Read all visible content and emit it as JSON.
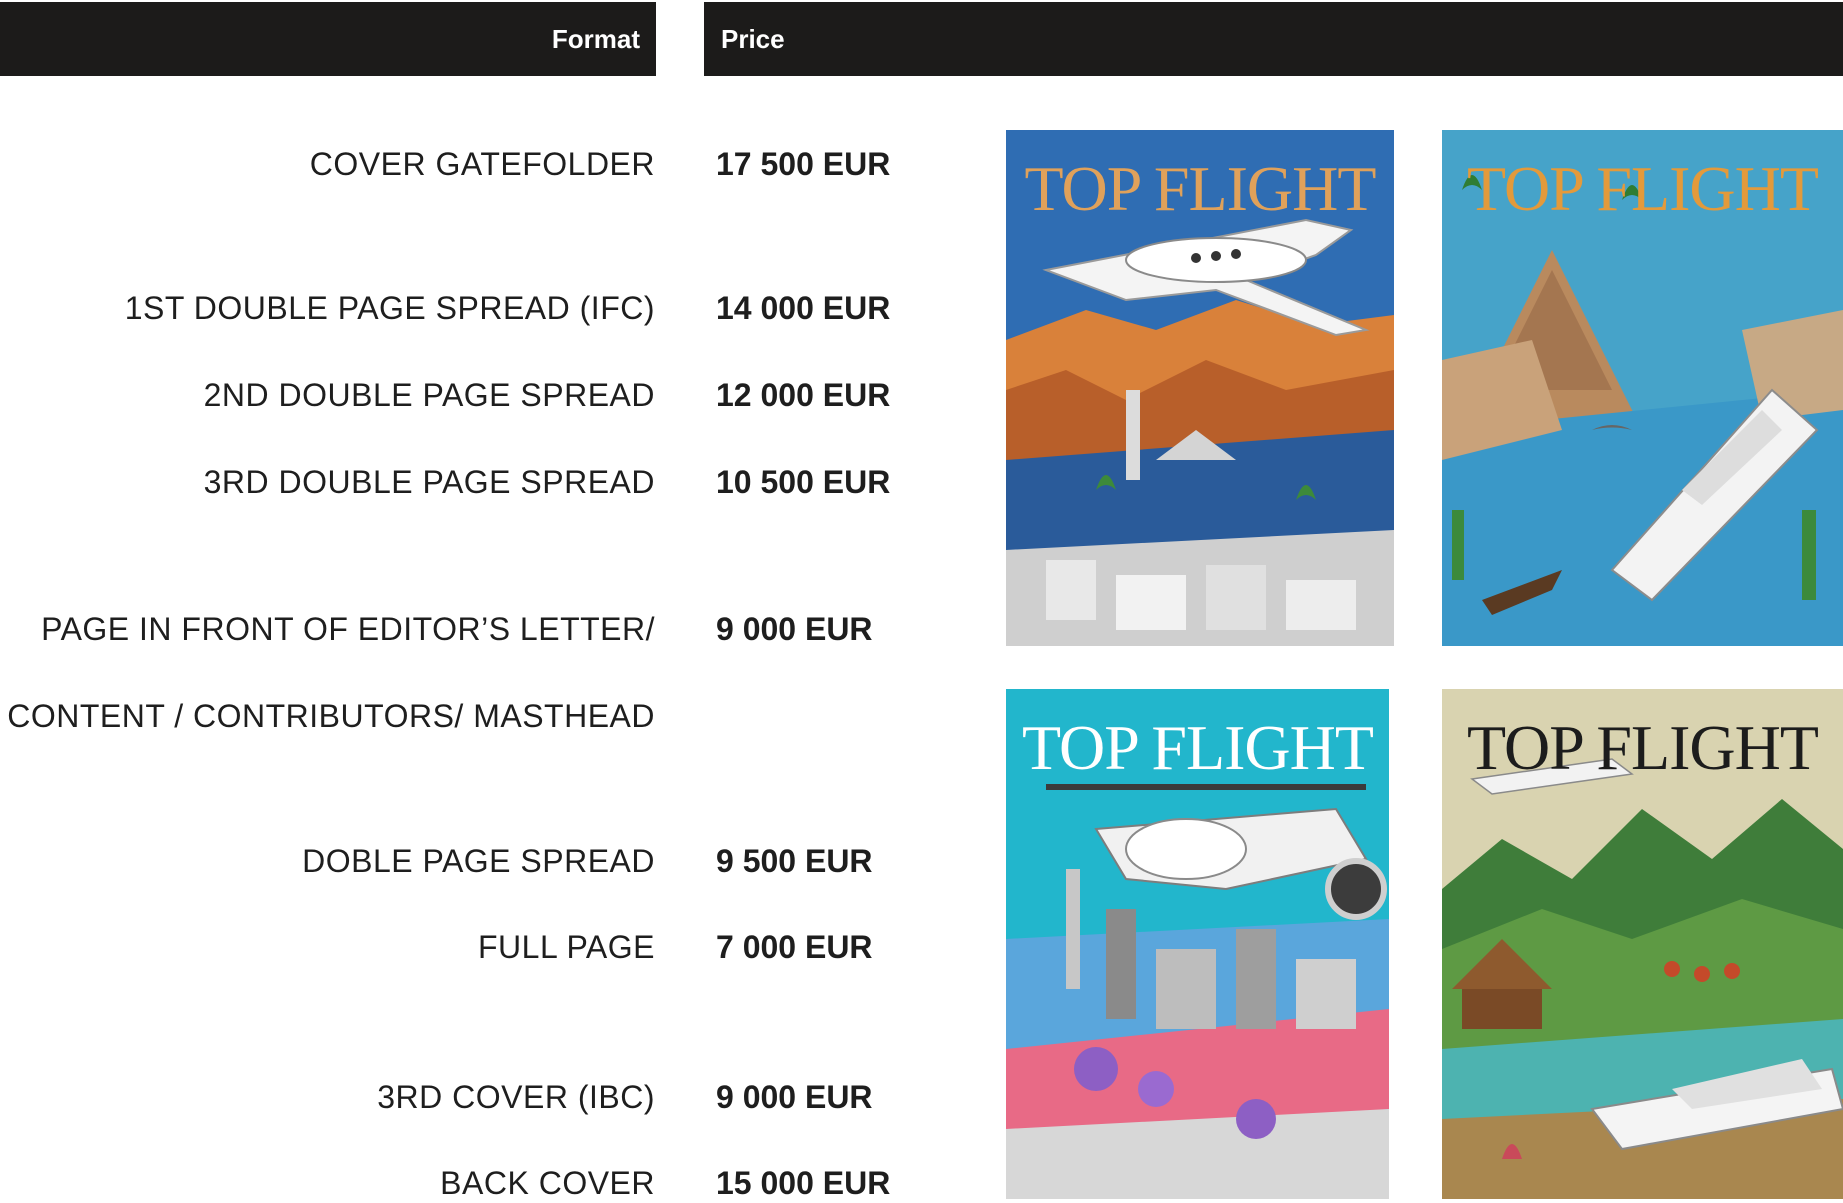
{
  "header": {
    "format_label": "Format",
    "price_label": "Price"
  },
  "rows": [
    {
      "format": "COVER GATEFOLDER",
      "price": "17 500 EUR"
    },
    {
      "format": "1ST DOUBLE PAGE SPREAD (IFC)",
      "price": "14 000 EUR"
    },
    {
      "format": "2ND DOUBLE PAGE SPREAD",
      "price": "12 000 EUR"
    },
    {
      "format": "3RD DOUBLE PAGE SPREAD",
      "price": "10 500 EUR"
    },
    {
      "format": "PAGE IN FRONT OF EDITOR’S LETTER/",
      "price": "9 000 EUR"
    },
    {
      "format": "CONTENT /  CONTRIBUTORS/  MASTHEAD",
      "price": ""
    },
    {
      "format": "DOBLE PAGE SPREAD",
      "price": "9 500 EUR"
    },
    {
      "format": "FULL PAGE",
      "price": "7 000 EUR"
    },
    {
      "format": "3RD COVER (IBC)",
      "price": "9 000 EUR"
    },
    {
      "format": "BACK COVER",
      "price": "15 000 EUR"
    }
  ],
  "covers": [
    {
      "title": "TOP FLIGHT",
      "bg": "#2f6db3",
      "title_color": "#e0a15a"
    },
    {
      "title": "TOP FLIGHT",
      "bg": "#46a3c9",
      "title_color": "#e39a3b"
    },
    {
      "title": "TOP FLIGHT",
      "bg": "#22b6cc",
      "title_color": "#ffffff"
    },
    {
      "title": "TOP FLIGHT",
      "bg": "#d9d3b0",
      "title_color": "#1c1c1c"
    }
  ]
}
